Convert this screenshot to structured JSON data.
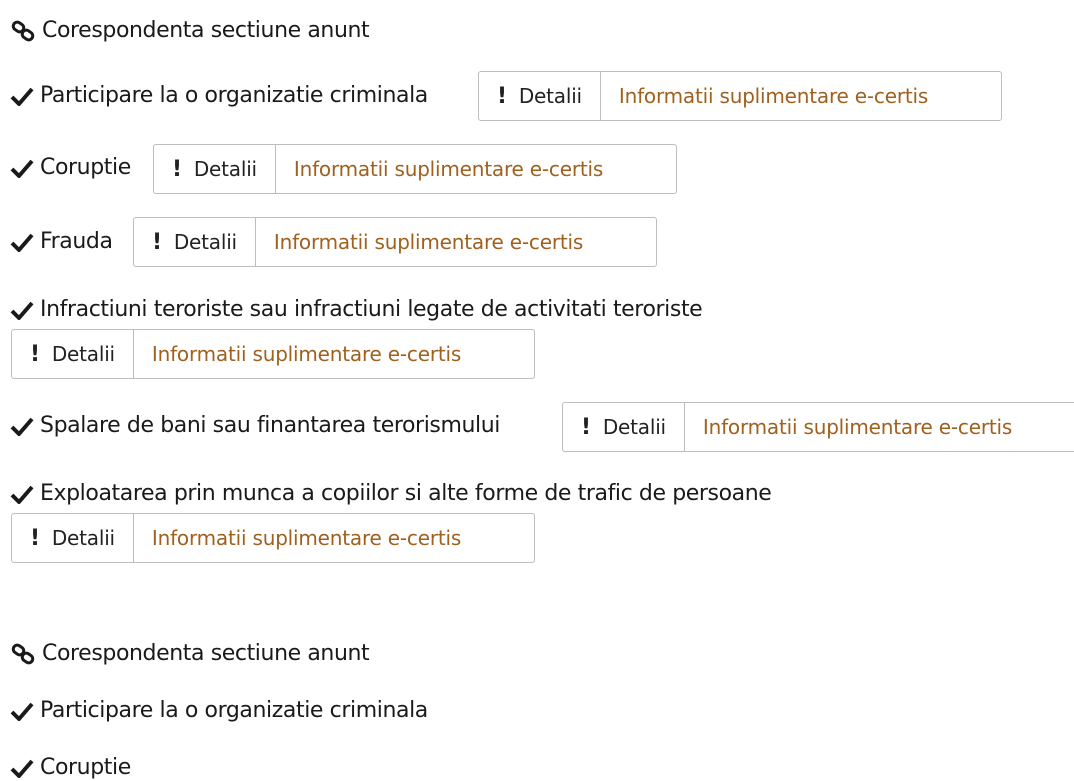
{
  "section1": {
    "heading": "Corespondenta sectiune anunt",
    "items": [
      {
        "label": "Participare la o organizatie criminala",
        "detail_label": "Detalii",
        "info_label": "Informatii suplimentare e-certis"
      },
      {
        "label": "Coruptie",
        "detail_label": "Detalii",
        "info_label": "Informatii suplimentare e-certis"
      },
      {
        "label": "Frauda",
        "detail_label": "Detalii",
        "info_label": "Informatii suplimentare e-certis"
      },
      {
        "label": "Infractiuni teroriste sau infractiuni legate de activitati teroriste",
        "detail_label": "Detalii",
        "info_label": "Informatii suplimentare e-certis"
      },
      {
        "label": "Spalare de bani sau finantarea terorismului",
        "detail_label": "Detalii",
        "info_label": "Informatii suplimentare e-certis"
      },
      {
        "label": "Exploatarea prin munca a copiilor si alte forme de trafic de persoane",
        "detail_label": "Detalii",
        "info_label": "Informatii suplimentare e-certis"
      }
    ]
  },
  "section2": {
    "heading": "Corespondenta sectiune anunt",
    "items": [
      {
        "label": "Participare la o organizatie criminala"
      },
      {
        "label": "Coruptie"
      }
    ]
  },
  "icons": {
    "link": "link-icon",
    "check": "check-icon",
    "exclamation": "exclamation-icon"
  },
  "colors": {
    "info_link": "#a0601e",
    "border": "#bdbdbd",
    "text": "#1a1a1a"
  }
}
